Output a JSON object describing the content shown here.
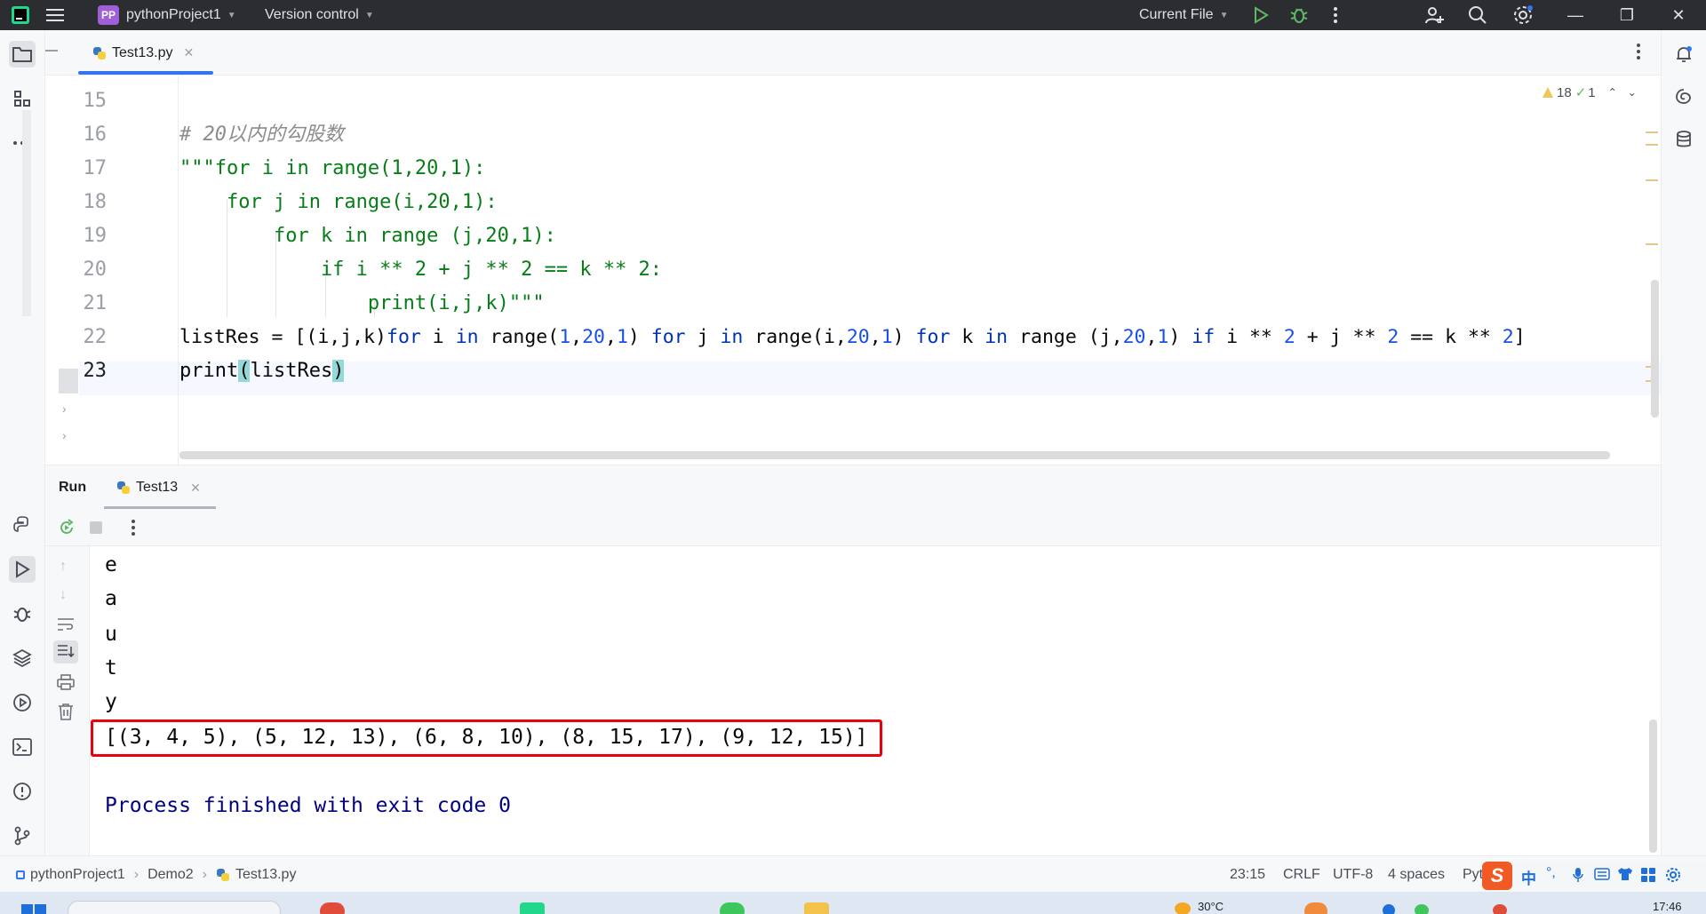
{
  "titlebar": {
    "project_badge": "PP",
    "project_name": "pythonProject1",
    "vcs_label": "Version control",
    "run_config": "Current File"
  },
  "editor": {
    "tab_label": "Test13.py",
    "warnings_count": "18",
    "checks_count": "1",
    "line_numbers": [
      "15",
      "16",
      "17",
      "18",
      "19",
      "20",
      "21",
      "22",
      "23"
    ],
    "lines": {
      "l16": "# 20以内的勾股数",
      "l17": "\"\"\"for i in range(1,20,1):",
      "l18": "    for j in range(i,20,1):",
      "l19": "        for k in range (j,20,1):",
      "l20": "            if i ** 2 + j ** 2 == k ** 2:",
      "l21": "                print(i,j,k)\"\"\"",
      "l22_a": "listRes = [(i,j,k)",
      "l22_for1": "for",
      "l22_b": " i ",
      "l22_in1": "in",
      "l22_c": " range(",
      "l22_n1": "1",
      "l22_d": ",",
      "l22_n2": "20",
      "l22_e": ",",
      "l22_n3": "1",
      "l22_f": ") ",
      "l22_for2": "for",
      "l22_g": " j ",
      "l22_in2": "in",
      "l22_h": " range(i,",
      "l22_n4": "20",
      "l22_i": ",",
      "l22_n5": "1",
      "l22_j": ") ",
      "l22_for3": "for",
      "l22_k": " k ",
      "l22_in3": "in",
      "l22_l": " range (j,",
      "l22_n6": "20",
      "l22_m": ",",
      "l22_n7": "1",
      "l22_n": ") ",
      "l22_if": "if",
      "l22_o": " i ** ",
      "l22_n8": "2",
      "l22_p": " + j ** ",
      "l22_n9": "2",
      "l22_q": " == k ** ",
      "l22_n10": "2",
      "l22_r": "]",
      "l23_a": "print",
      "l23_b": "(",
      "l23_c": "listRes",
      "l23_d": ")"
    }
  },
  "run_panel": {
    "title": "Run",
    "tab_label": "Test13",
    "output_lines": [
      "e",
      "a",
      "u",
      "t",
      "y"
    ],
    "result": "[(3, 4, 5), (5, 12, 13), (6, 8, 10), (8, 15, 17), (9, 12, 15)]",
    "exit_message": "Process finished with exit code 0"
  },
  "statusbar": {
    "breadcrumb": [
      "pythonProject1",
      "Demo2",
      "Test13.py"
    ],
    "position": "23:15",
    "line_sep": "CRLF",
    "encoding": "UTF-8",
    "indent": "4 spaces",
    "interpreter_partial": "Pyt",
    "ime_lang": "中"
  },
  "taskbar": {
    "temperature": "30°C",
    "time": "17:46"
  },
  "colors": {
    "accent": "#3574f0",
    "highlight_border": "#e8000b",
    "titlebar_bg": "#2b2d30"
  }
}
